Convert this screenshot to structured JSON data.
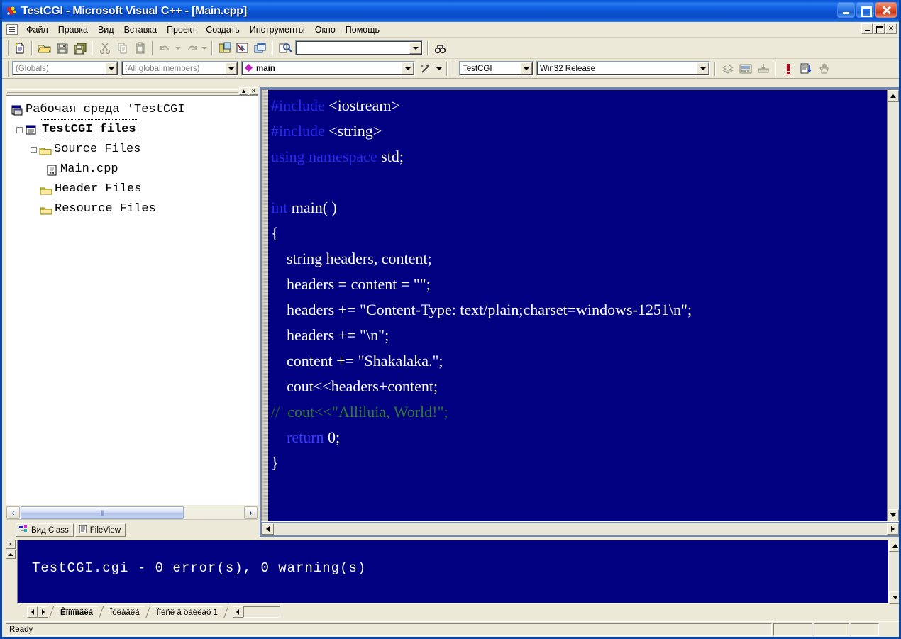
{
  "window": {
    "title": "TestCGI - Microsoft Visual C++ - [Main.cpp]",
    "app_icon": "visual-cpp-icon",
    "minimize_label": "",
    "maximize_label": "",
    "close_label": ""
  },
  "menu": {
    "items": [
      {
        "label": "Файл"
      },
      {
        "label": "Правка"
      },
      {
        "label": "Вид"
      },
      {
        "label": "Вставка"
      },
      {
        "label": "Проект"
      },
      {
        "label": "Создать"
      },
      {
        "label": "Инструменты"
      },
      {
        "label": "Окно"
      },
      {
        "label": "Помощь"
      }
    ],
    "mdi": {
      "restore": "–",
      "maximize": "□",
      "close": "✕"
    }
  },
  "toolbar_standard": {
    "buttons": [
      {
        "name": "new-file-icon",
        "tooltip": "New"
      },
      {
        "name": "open-file-icon",
        "tooltip": "Open"
      },
      {
        "name": "save-icon",
        "tooltip": "Save"
      },
      {
        "name": "save-all-icon",
        "tooltip": "Save All"
      },
      {
        "name": "cut-icon",
        "tooltip": "Cut"
      },
      {
        "name": "copy-icon",
        "tooltip": "Copy"
      },
      {
        "name": "paste-icon",
        "tooltip": "Paste"
      },
      {
        "name": "undo-icon",
        "tooltip": "Undo"
      },
      {
        "name": "redo-icon",
        "tooltip": "Redo"
      },
      {
        "name": "workspace-icon",
        "tooltip": "Workspace"
      },
      {
        "name": "output-window-icon",
        "tooltip": "Output"
      },
      {
        "name": "window-list-icon",
        "tooltip": "Windows"
      },
      {
        "name": "find-in-files-icon",
        "tooltip": "Find in Files"
      },
      {
        "name": "search-binoculars-icon",
        "tooltip": "Find"
      }
    ],
    "find_box": {
      "value": "",
      "placeholder": ""
    }
  },
  "toolbar_wizard": {
    "globals_combo": {
      "value": "(Globals)"
    },
    "members_combo": {
      "value": "(All global members)"
    },
    "symbol_combo": {
      "value": "main",
      "icon": "member-diamond-icon"
    },
    "wizard_icon": "magic-wand-icon",
    "project_combo": {
      "value": "TestCGI"
    },
    "config_combo": {
      "value": "Win32 Release"
    },
    "buttons": [
      {
        "name": "compile-icon"
      },
      {
        "name": "build-icon"
      },
      {
        "name": "stop-build-icon"
      },
      {
        "name": "insert-breakpoint-icon"
      },
      {
        "name": "breakpoints-list-icon"
      },
      {
        "name": "hand-icon"
      }
    ]
  },
  "workspace": {
    "caption_buttons": [
      {
        "name": "dock-pin-button",
        "glyph": "▲"
      },
      {
        "name": "close-panel-button",
        "glyph": "✕"
      }
    ],
    "tree": [
      {
        "label": "Рабочая среда 'TestCGI",
        "icon": "workspace-icon",
        "depth": 0,
        "expander": "none",
        "selected": false
      },
      {
        "label": "TestCGI files",
        "icon": "project-icon",
        "depth": 0,
        "expander": "minus",
        "selected": true
      },
      {
        "label": "Source Files",
        "icon": "folder-icon",
        "depth": 1,
        "expander": "minus",
        "selected": false
      },
      {
        "label": "Main.cpp",
        "icon": "cpp-file-icon",
        "depth": 2,
        "expander": "none",
        "selected": false
      },
      {
        "label": "Header Files",
        "icon": "folder-icon",
        "depth": 1,
        "expander": "none",
        "selected": false
      },
      {
        "label": "Resource Files",
        "icon": "folder-icon",
        "depth": 1,
        "expander": "none",
        "selected": false
      }
    ],
    "tabs": [
      {
        "label": "Вид Class",
        "icon": "class-view-icon",
        "active": false
      },
      {
        "label": "FileView",
        "icon": "file-view-icon",
        "active": true
      }
    ]
  },
  "editor": {
    "filename": "Main.cpp",
    "lines": [
      [
        {
          "t": "#include",
          "c": "kw"
        },
        {
          "t": " <iostream>",
          "c": ""
        }
      ],
      [
        {
          "t": "#include",
          "c": "kw"
        },
        {
          "t": " <string>",
          "c": ""
        }
      ],
      [
        {
          "t": "using namespace",
          "c": "kw"
        },
        {
          "t": " std;",
          "c": ""
        }
      ],
      [
        {
          "t": "",
          "c": ""
        }
      ],
      [
        {
          "t": "int",
          "c": "kw"
        },
        {
          "t": " main( )",
          "c": ""
        }
      ],
      [
        {
          "t": "{",
          "c": ""
        }
      ],
      [
        {
          "t": "    string headers, content;",
          "c": ""
        }
      ],
      [
        {
          "t": "    headers = content = \"\";",
          "c": ""
        }
      ],
      [
        {
          "t": "    headers += \"Content-Type: text/plain;charset=windows-1251\\n\";",
          "c": ""
        }
      ],
      [
        {
          "t": "    headers += \"\\n\";",
          "c": ""
        }
      ],
      [
        {
          "t": "    content += \"Shakalaka.\";",
          "c": ""
        }
      ],
      [
        {
          "t": "    cout<<headers+content;",
          "c": ""
        }
      ],
      [
        {
          "t": "//",
          "c": "cmt"
        },
        {
          "t": "  cout<<\"Alliluia, World!\";",
          "c": "cmt2"
        }
      ],
      [
        {
          "t": "    ",
          "c": ""
        },
        {
          "t": "return",
          "c": "kw2"
        },
        {
          "t": " 0;",
          "c": ""
        }
      ],
      [
        {
          "t": "}",
          "c": ""
        }
      ]
    ]
  },
  "output": {
    "text": "TestCGI.cgi - 0 error(s), 0 warning(s)",
    "close_glyph": "✕",
    "tabs": [
      {
        "label": "Êîìïîíîâêà",
        "active": true
      },
      {
        "label": "Îòëàäêà",
        "active": false
      },
      {
        "label": "Ïîèñê â ôàéëàõ 1",
        "active": false
      }
    ]
  },
  "statusbar": {
    "text": "Ready"
  },
  "colors": {
    "title_blue": "#0b51cf",
    "editor_bg": "#000080",
    "keyword_blue": "#2a2af0",
    "comment_green": "#1d7a1d",
    "chrome": "#ece9d8",
    "mdi_back": "#6f86b9"
  }
}
